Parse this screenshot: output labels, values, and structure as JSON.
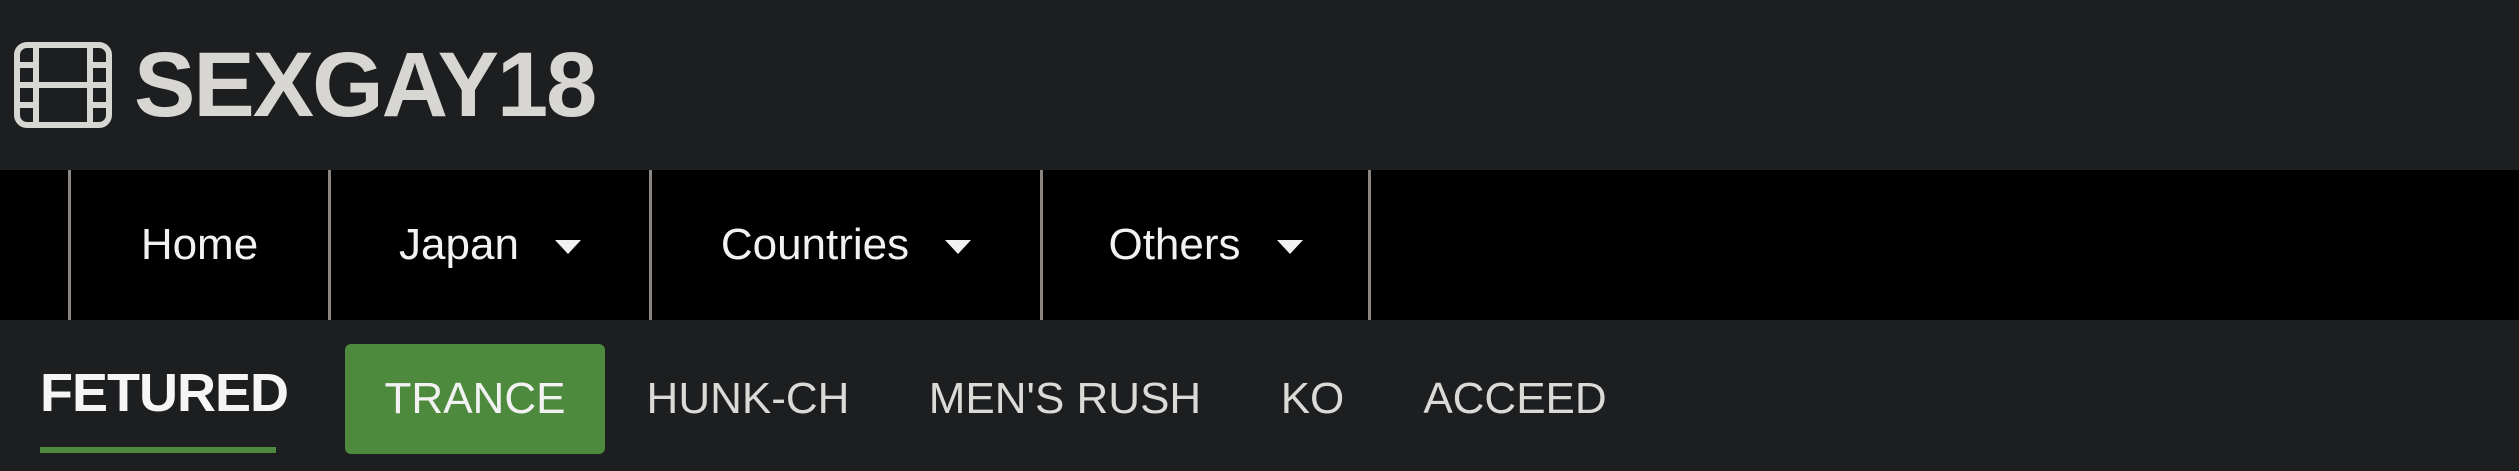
{
  "header": {
    "logo_icon": "film-icon",
    "site_name": "SEXGAY18"
  },
  "nav": {
    "items": [
      {
        "label": "Home",
        "has_dropdown": false
      },
      {
        "label": "Japan",
        "has_dropdown": true
      },
      {
        "label": "Countries",
        "has_dropdown": true
      },
      {
        "label": "Others",
        "has_dropdown": true
      }
    ]
  },
  "featured": {
    "heading": "FETURED",
    "tabs": [
      {
        "label": "TRANCE",
        "active": true
      },
      {
        "label": "HUNK-CH",
        "active": false
      },
      {
        "label": "MEN'S RUSH",
        "active": false
      },
      {
        "label": "KO",
        "active": false
      },
      {
        "label": "ACCEED",
        "active": false
      }
    ]
  },
  "colors": {
    "background": "#1d1e20",
    "navbar": "#000000",
    "accent": "#4e8a3e",
    "text": "#d8d6d2",
    "divider": "#8a8580"
  }
}
